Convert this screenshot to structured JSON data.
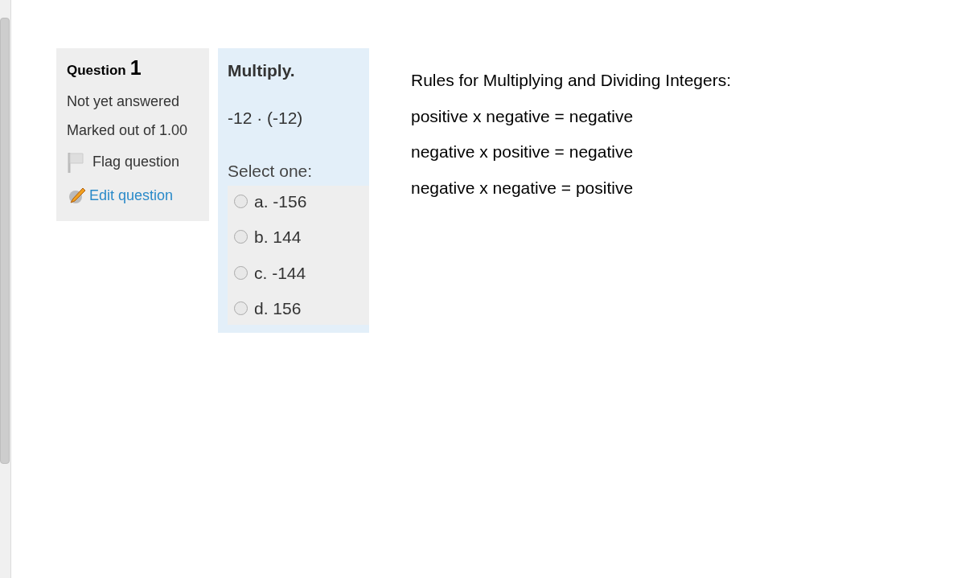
{
  "info": {
    "label": "Question",
    "number": "1",
    "status": "Not yet answered",
    "marks": "Marked out of 1.00",
    "flag": {
      "label": "Flag question",
      "flagged": false
    },
    "edit": "Edit question"
  },
  "question": {
    "title": "Multiply.",
    "expression": "-12 · (-12)",
    "prompt": "Select one:",
    "options": [
      {
        "label": "a. -156",
        "selected": false
      },
      {
        "label": "b. 144",
        "selected": false
      },
      {
        "label": "c. -144",
        "selected": false
      },
      {
        "label": "d. 156",
        "selected": false
      }
    ]
  },
  "rules": {
    "title": "Rules for Multiplying and Dividing Integers:",
    "lines": [
      "positive x negative = negative",
      "negative x positive = negative",
      "negative x negative = positive"
    ]
  }
}
